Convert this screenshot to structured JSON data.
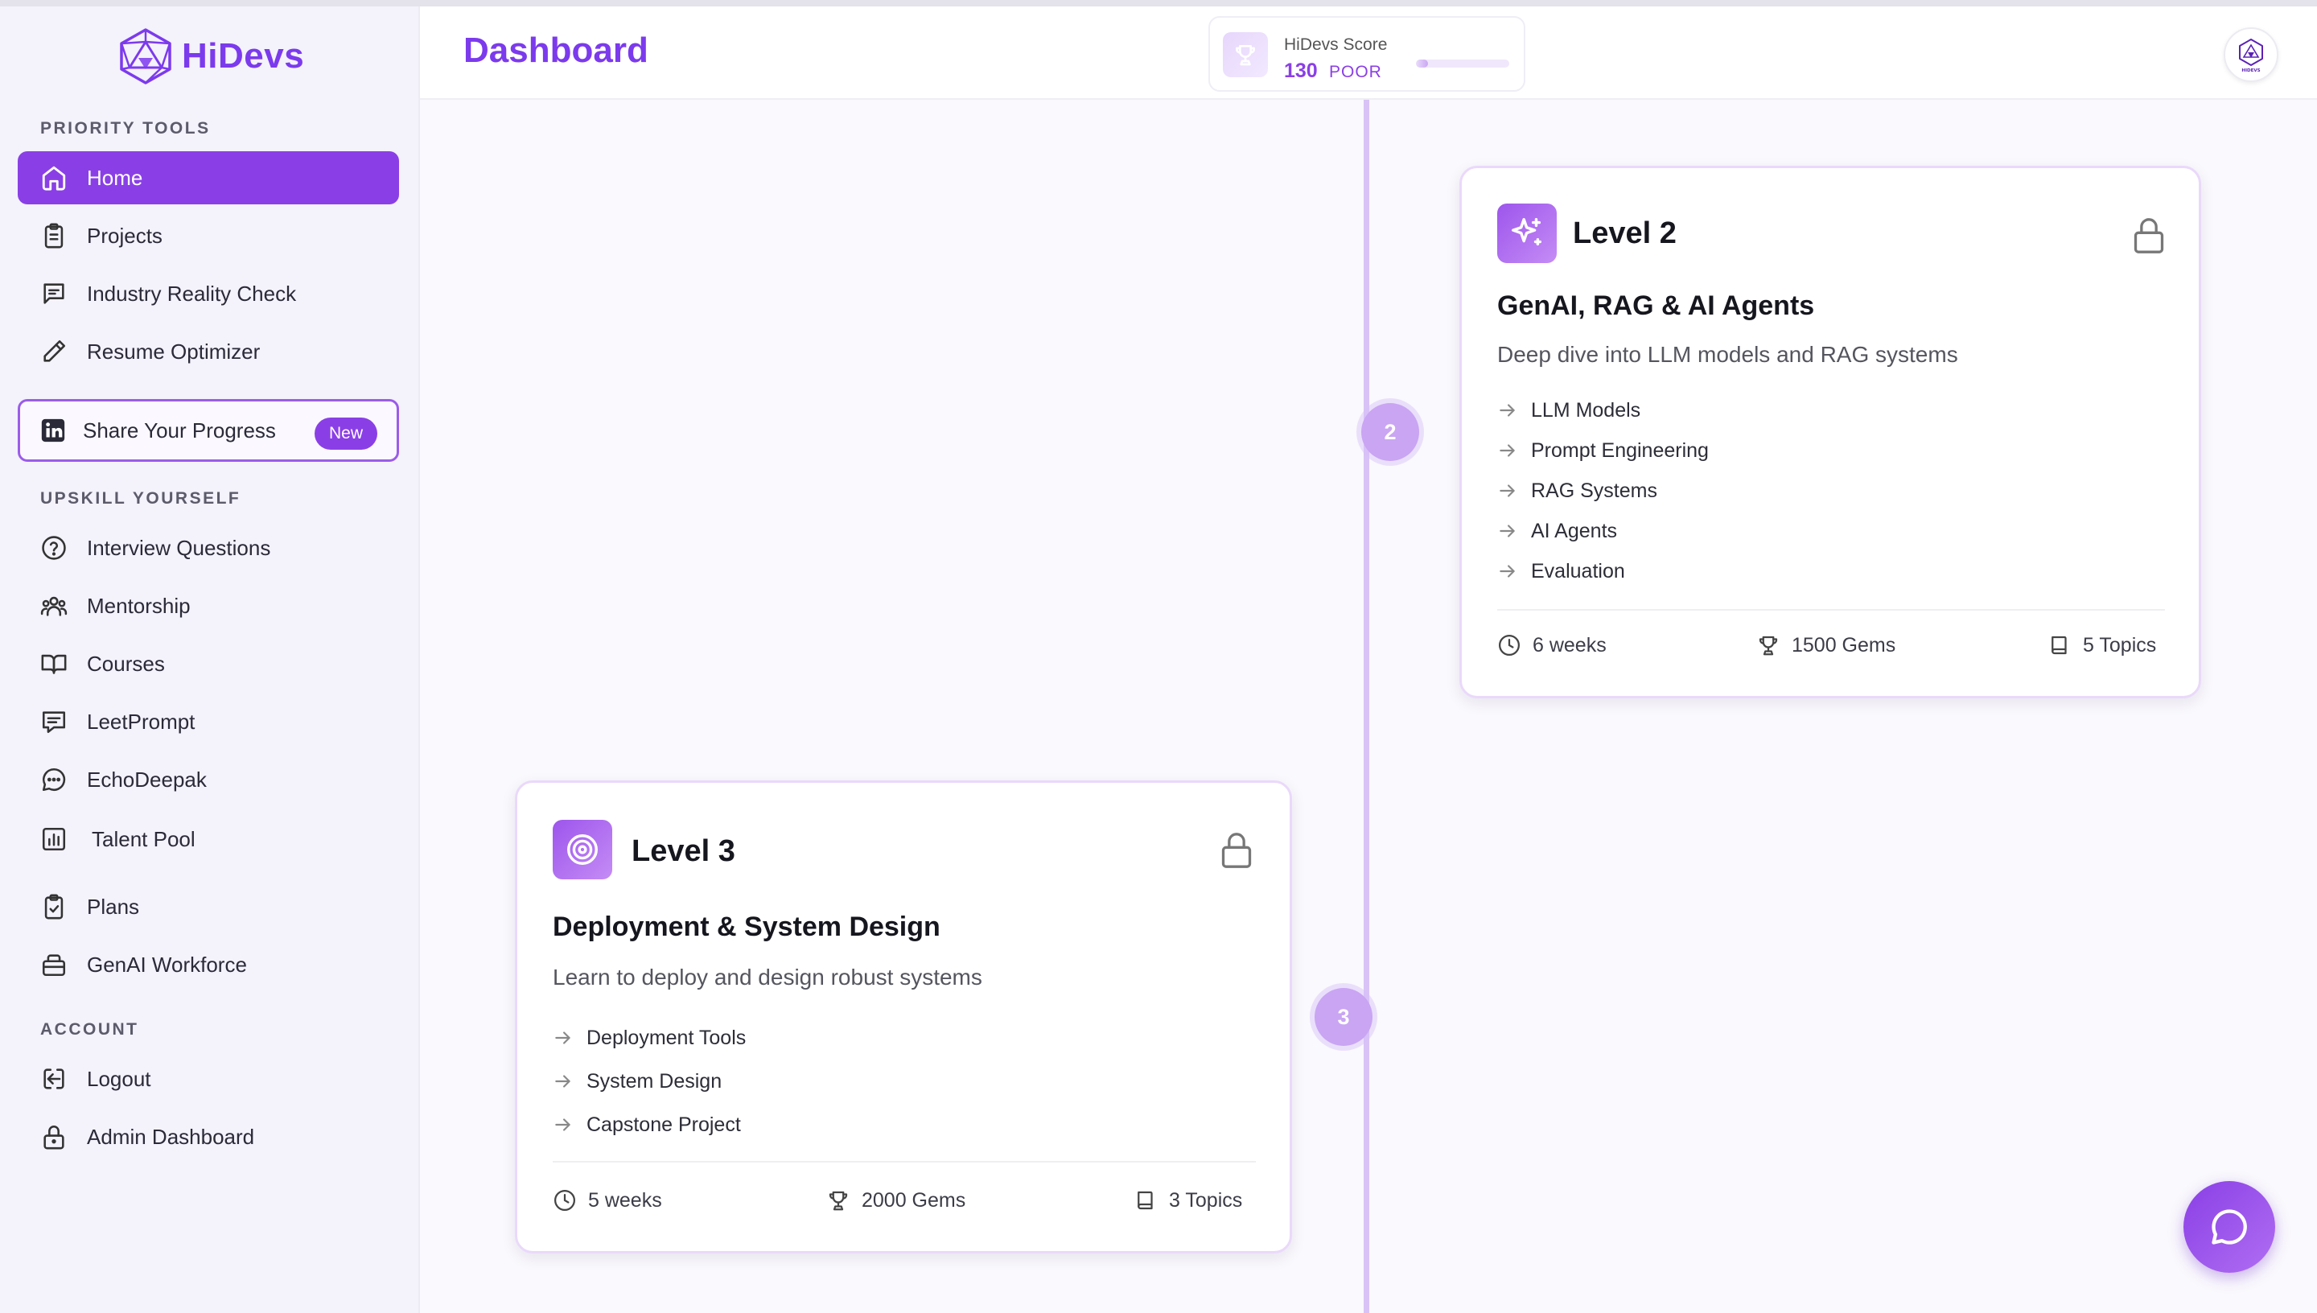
{
  "app": {
    "brand": "HiDevs",
    "page_title": "Dashboard",
    "accent_color": "#7c3aed",
    "avatar_text": "HIDEVS"
  },
  "score": {
    "label": "HiDevs Score",
    "value": "130",
    "status": "POOR",
    "progress_fraction": 0.13,
    "icon": "trophy-icon"
  },
  "sidebar": {
    "priority_label": "PRIORITY TOOLS",
    "priority_items": [
      {
        "label": "Home",
        "icon": "home-icon",
        "active": true
      },
      {
        "label": "Projects",
        "icon": "clipboard-icon"
      },
      {
        "label": "Industry Reality Check",
        "icon": "message-square-icon"
      },
      {
        "label": "Resume Optimizer",
        "icon": "pencil-icon"
      }
    ],
    "share": {
      "label": "Share Your Progress",
      "badge": "New",
      "icon": "linkedin-icon"
    },
    "upskill_label": "UPSKILL YOURSELF",
    "upskill_items": [
      {
        "label": "Interview Questions",
        "icon": "help-circle-icon"
      },
      {
        "label": "Mentorship",
        "icon": "users-icon"
      },
      {
        "label": "Courses",
        "icon": "book-open-icon"
      },
      {
        "label": "LeetPrompt",
        "icon": "message-lines-icon"
      },
      {
        "label": "EchoDeepak",
        "icon": "chat-bubble-icon"
      },
      {
        "label": "Talent Pool",
        "icon": "bar-chart-icon"
      },
      {
        "label": "Plans",
        "icon": "clipboard-check-icon"
      },
      {
        "label": "GenAI Workforce",
        "icon": "briefcase-icon"
      }
    ],
    "account_label": "ACCOUNT",
    "account_items": [
      {
        "label": "Logout",
        "icon": "logout-icon"
      },
      {
        "label": "Admin Dashboard",
        "icon": "lock-icon"
      }
    ]
  },
  "levels": [
    {
      "step": "2",
      "level": "Level 2",
      "icon": "sparkles-icon",
      "title": "GenAI, RAG & AI Agents",
      "description": "Deep dive into LLM models and RAG systems",
      "topics": [
        "LLM Models",
        "Prompt Engineering",
        "RAG Systems",
        "AI Agents",
        "Evaluation"
      ],
      "duration": "6 weeks",
      "gems": "1500 Gems",
      "topic_count": "5 Topics",
      "locked": true
    },
    {
      "step": "3",
      "level": "Level 3",
      "icon": "target-icon",
      "title": "Deployment & System Design",
      "description": "Learn to deploy and design robust systems",
      "topics": [
        "Deployment Tools",
        "System Design",
        "Capstone Project"
      ],
      "duration": "5 weeks",
      "gems": "2000 Gems",
      "topic_count": "3 Topics",
      "locked": true
    }
  ]
}
